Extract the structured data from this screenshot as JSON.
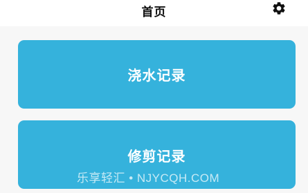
{
  "header": {
    "title": "首页",
    "settings_icon": "gear-icon"
  },
  "cards": [
    {
      "label": "浇水记录"
    },
    {
      "label": "修剪记录"
    }
  ],
  "watermark": "乐享轻汇 • NJYCQH.COM",
  "colors": {
    "header_bg": "#ffffff",
    "page_bg": "#f7f7f7",
    "card_bg": "#35b2dc",
    "card_text": "#ffffff"
  }
}
